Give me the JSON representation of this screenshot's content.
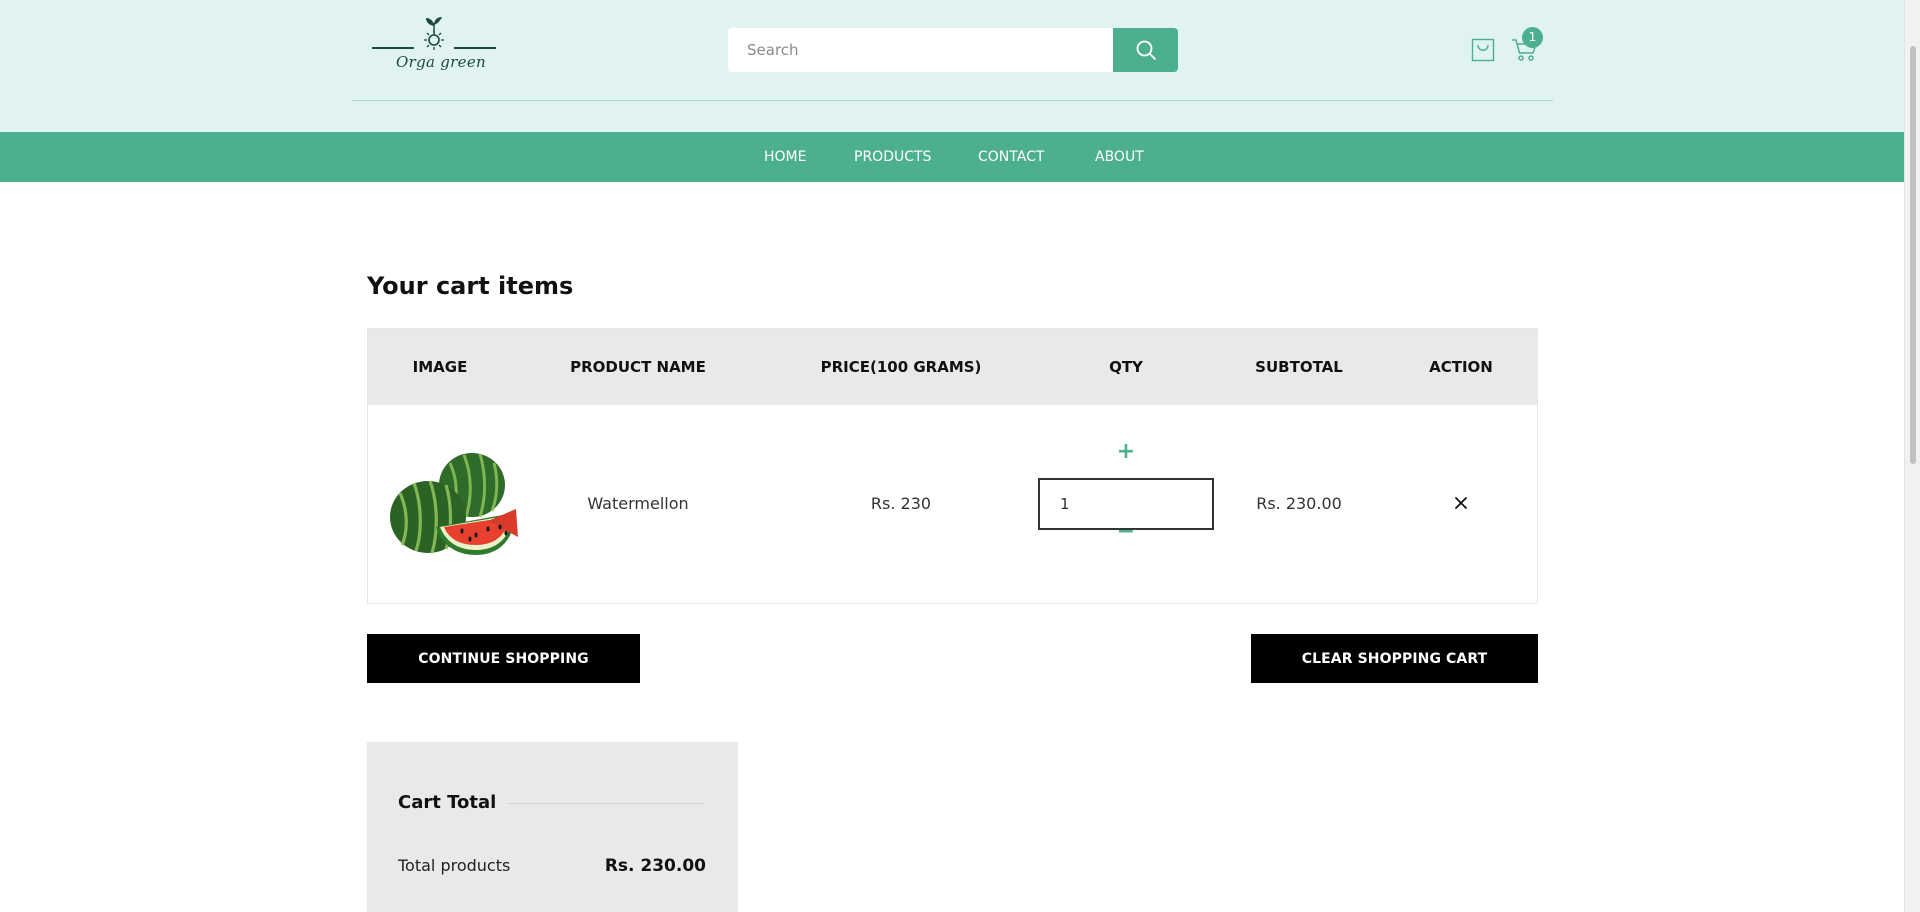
{
  "header": {
    "logo_text": "Orga green",
    "search": {
      "placeholder": "Search",
      "value": ""
    },
    "cart_count": "1"
  },
  "nav": {
    "items": [
      {
        "label": "HOME"
      },
      {
        "label": "PRODUCTS"
      },
      {
        "label": "CONTACT"
      },
      {
        "label": "ABOUT"
      }
    ]
  },
  "cart": {
    "title": "Your cart items",
    "columns": [
      "IMAGE",
      "PRODUCT NAME",
      "PRICE(100 GRAMS)",
      "QTY",
      "SUBTOTAL",
      "ACTION"
    ],
    "items": [
      {
        "image_icon": "watermelon-image",
        "name": "Watermellon",
        "price": "Rs. 230",
        "qty": "1",
        "subtotal": "Rs. 230.00"
      }
    ]
  },
  "actions": {
    "continue_label": "CONTINUE SHOPPING",
    "clear_label": "CLEAR SHOPPING CART"
  },
  "totals": {
    "title": "Cart Total",
    "products_label": "Total products",
    "products_value": "Rs. 230.00"
  },
  "colors": {
    "header_bg": "#e0f3f1",
    "accent": "#4caf90",
    "logo_dark": "#1d4a3f"
  }
}
